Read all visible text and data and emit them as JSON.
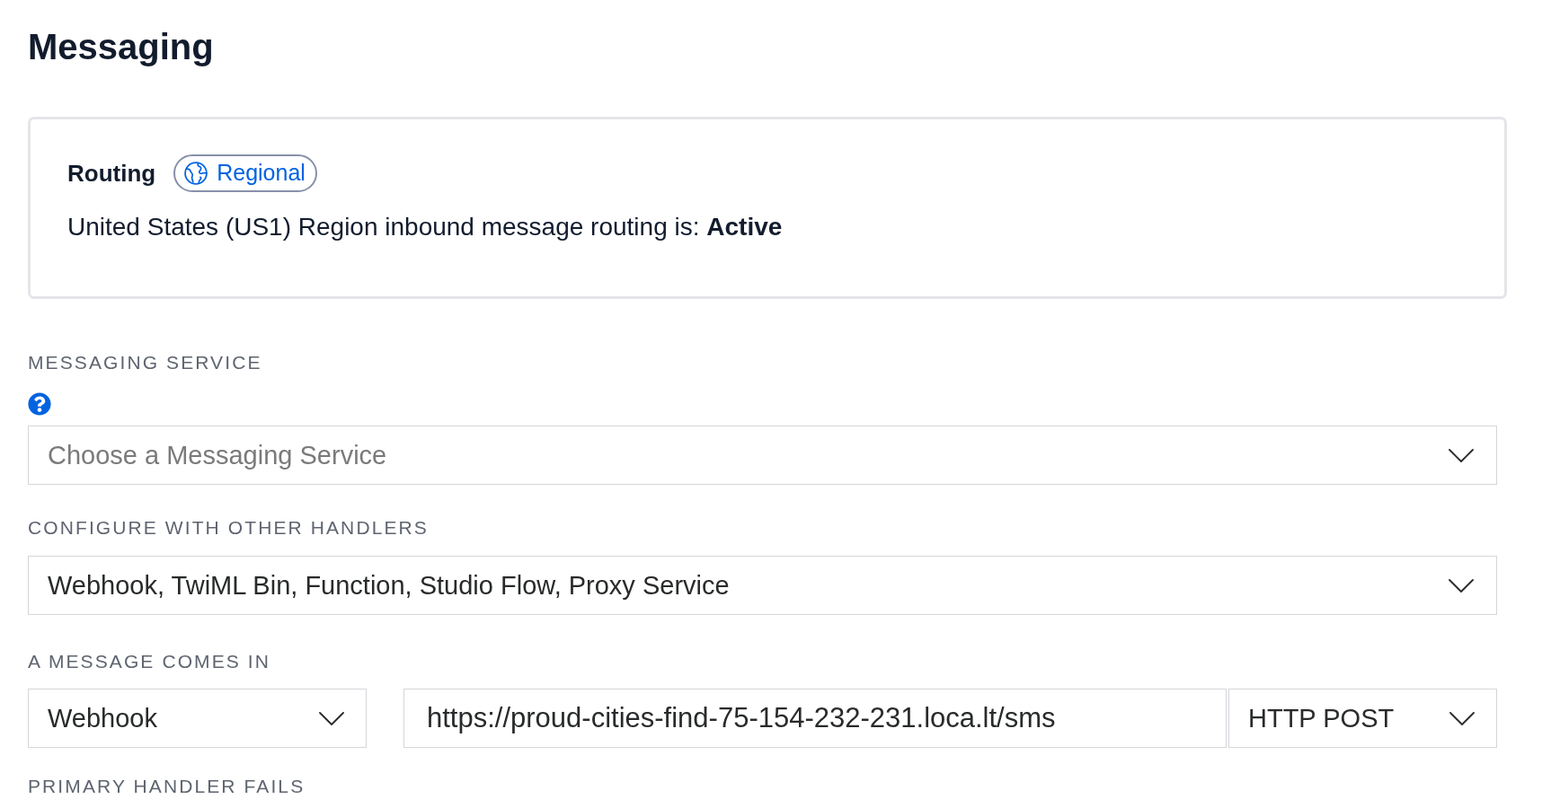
{
  "page": {
    "title": "Messaging"
  },
  "routing": {
    "title": "Routing",
    "badge": "Regional",
    "status": "United States (US1) Region inbound message routing is: **Active**"
  },
  "fields": [
    {
      "kind": "select",
      "label": "MESSAGING SERVICE",
      "help_icon": true,
      "placeholder": "Choose a Messaging Service"
    },
    {
      "kind": "select",
      "label": "CONFIGURE WITH OTHER HANDLERS",
      "help_icon": false,
      "value": "Webhook, TwiML Bin, Function, Studio Flow, Proxy Service"
    },
    {
      "kind": "handler",
      "label": "A MESSAGE COMES IN",
      "help_icon": false,
      "handler_type": "Webhook",
      "url": "https://proud-cities-find-75-154-232-231.loca.lt/sms",
      "method": "HTTP POST"
    },
    {
      "kind": "heading",
      "label": "PRIMARY HANDLER FAILS",
      "help_icon": false
    }
  ]
}
